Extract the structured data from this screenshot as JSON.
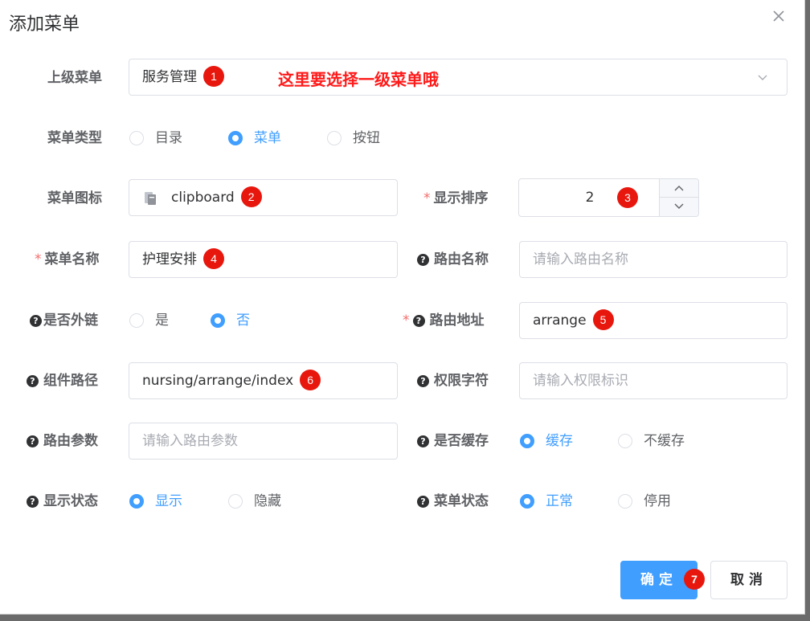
{
  "dialog": {
    "title": "添加菜单",
    "close_icon": "close-icon"
  },
  "form": {
    "parent_menu": {
      "label": "上级菜单",
      "value": "服务管理",
      "badge": "1",
      "annotation": "这里要选择一级菜单哦"
    },
    "menu_type": {
      "label": "菜单类型",
      "options": [
        "目录",
        "菜单",
        "按钮"
      ],
      "selected": "菜单"
    },
    "menu_icon": {
      "label": "菜单图标",
      "value": "clipboard",
      "icon": "clipboard-icon",
      "badge": "2"
    },
    "order": {
      "required": "*",
      "label": "显示排序",
      "value": "2",
      "badge": "3"
    },
    "menu_name": {
      "required": "*",
      "label": "菜单名称",
      "value": "护理安排",
      "badge": "4"
    },
    "route_name": {
      "label": "路由名称",
      "placeholder": "请输入路由名称"
    },
    "is_frame": {
      "label": "是否外链",
      "options": [
        "是",
        "否"
      ],
      "selected": "否"
    },
    "route_path": {
      "required": "*",
      "label": "路由地址",
      "value": "arrange",
      "badge": "5"
    },
    "component": {
      "label": "组件路径",
      "value": "nursing/arrange/index",
      "badge": "6"
    },
    "perms": {
      "label": "权限字符",
      "placeholder": "请输入权限标识"
    },
    "query": {
      "label": "路由参数",
      "placeholder": "请输入路由参数"
    },
    "is_cache": {
      "label": "是否缓存",
      "options": [
        "缓存",
        "不缓存"
      ],
      "selected": "缓存"
    },
    "visible": {
      "label": "显示状态",
      "options": [
        "显示",
        "隐藏"
      ],
      "selected": "显示"
    },
    "status": {
      "label": "菜单状态",
      "options": [
        "正常",
        "停用"
      ],
      "selected": "正常"
    }
  },
  "footer": {
    "confirm_label": "确定",
    "confirm_badge": "7",
    "cancel_label": "取消"
  },
  "colors": {
    "primary": "#409eff",
    "badge": "#e8170e",
    "annotation": "#ff1a1a",
    "required": "#f56c6c"
  }
}
